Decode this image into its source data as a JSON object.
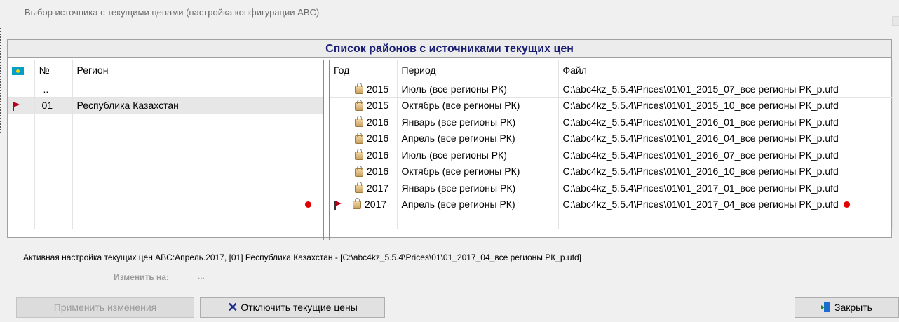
{
  "window": {
    "title": "Выбор источника с текущими ценами (настройка конфигурации ABC)"
  },
  "panel": {
    "header": "Список районов с источниками текущих цен"
  },
  "regions": {
    "columns": [
      "№",
      "Регион"
    ],
    "rows": [
      {
        "num": "..",
        "name": ""
      },
      {
        "num": "01",
        "name": "Республика Казахстан"
      }
    ]
  },
  "prices": {
    "columns": [
      "Год",
      "Период",
      "Файл"
    ],
    "rows": [
      {
        "year": "2015",
        "period": "Июль (все регионы РК)",
        "file": "C:\\abc4kz_5.5.4\\Prices\\01\\01_2015_07_все регионы РК_p.ufd"
      },
      {
        "year": "2015",
        "period": "Октябрь (все регионы РК)",
        "file": "C:\\abc4kz_5.5.4\\Prices\\01\\01_2015_10_все регионы РК_p.ufd"
      },
      {
        "year": "2016",
        "period": "Январь (все регионы РК)",
        "file": "C:\\abc4kz_5.5.4\\Prices\\01\\01_2016_01_все регионы РК_p.ufd"
      },
      {
        "year": "2016",
        "period": "Апрель (все регионы РК)",
        "file": "C:\\abc4kz_5.5.4\\Prices\\01\\01_2016_04_все регионы РК_p.ufd"
      },
      {
        "year": "2016",
        "period": "Июль (все регионы РК)",
        "file": "C:\\abc4kz_5.5.4\\Prices\\01\\01_2016_07_все регионы РК_p.ufd"
      },
      {
        "year": "2016",
        "period": "Октябрь (все регионы РК)",
        "file": "C:\\abc4kz_5.5.4\\Prices\\01\\01_2016_10_все регионы РК_p.ufd"
      },
      {
        "year": "2017",
        "period": "Январь (все регионы РК)",
        "file": "C:\\abc4kz_5.5.4\\Prices\\01\\01_2017_01_все регионы РК_p.ufd"
      },
      {
        "year": "2017",
        "period": "Апрель (все регионы РК)",
        "file": "C:\\abc4kz_5.5.4\\Prices\\01\\01_2017_04_все регионы РК_p.ufd"
      }
    ]
  },
  "status": {
    "active": "Активная настройка текущих цен ABC:Апрель.2017, [01] Республика Казахстан - [C:\\abc4kz_5.5.4\\Prices\\01\\01_2017_04_все регионы РК_p.ufd]",
    "change_label": "Изменить на:",
    "change_value": "..."
  },
  "buttons": {
    "apply": "Применить изменения",
    "disable": "Отключить текущие цены",
    "close": "Закрыть"
  },
  "colors": {
    "header_text": "#1a1f73",
    "marker": "#e00000",
    "flag": "#b3001b"
  },
  "icons": {
    "kazakhstan": "kazakhstan-flag-icon",
    "current": "red-flag-icon",
    "lock": "lock-icon",
    "disable": "x-icon",
    "close": "exit-door-icon"
  }
}
